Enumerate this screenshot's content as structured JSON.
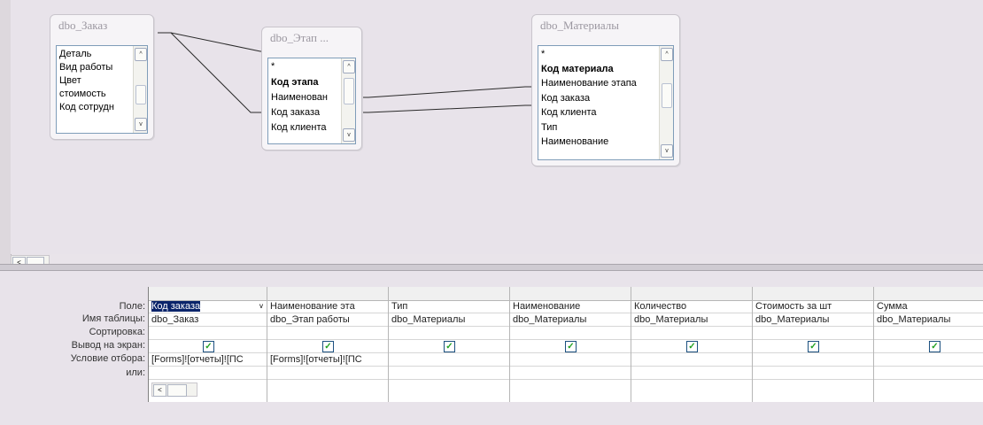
{
  "design": {
    "tables": [
      {
        "title": "dbo_Заказ",
        "fields": [
          "Деталь",
          "Вид работы",
          "Цвет",
          "стоимость",
          "Код сотрудн"
        ],
        "bold": []
      },
      {
        "title": "dbo_Этап ...",
        "fields": [
          "*",
          "Код этапа",
          "Наименован",
          "Код заказа",
          "Код клиента"
        ],
        "bold": [
          1
        ]
      },
      {
        "title": "dbo_Материалы",
        "fields": [
          "*",
          "Код материала",
          "Наименование этапа",
          "Код заказа",
          "Код клиента",
          "Тип",
          "Наименование"
        ],
        "bold": [
          1
        ]
      }
    ],
    "scroll_left": "<",
    "scroll_up": "^",
    "scroll_down": "v"
  },
  "grid": {
    "row_labels": [
      "Поле:",
      "Имя таблицы:",
      "Сортировка:",
      "Вывод на экран:",
      "Условие отбора:",
      "или:"
    ],
    "columns": [
      {
        "field": "Код заказа",
        "table": "dbo_Заказ",
        "sort": "",
        "show": true,
        "criteria": "[Forms]![отчеты]![ПС",
        "or": ""
      },
      {
        "field": "Наименование эта",
        "table": "dbo_Этап работы",
        "sort": "",
        "show": true,
        "criteria": "[Forms]![отчеты]![ПС",
        "or": ""
      },
      {
        "field": "Тип",
        "table": "dbo_Материалы",
        "sort": "",
        "show": true,
        "criteria": "",
        "or": ""
      },
      {
        "field": "Наименование",
        "table": "dbo_Материалы",
        "sort": "",
        "show": true,
        "criteria": "",
        "or": ""
      },
      {
        "field": "Количество",
        "table": "dbo_Материалы",
        "sort": "",
        "show": true,
        "criteria": "",
        "or": ""
      },
      {
        "field": "Стоимость за шт",
        "table": "dbo_Материалы",
        "sort": "",
        "show": true,
        "criteria": "",
        "or": ""
      },
      {
        "field": "Сумма",
        "table": "dbo_Материалы",
        "sort": "",
        "show": true,
        "criteria": "",
        "or": ""
      }
    ],
    "dropdown_glyph": "v",
    "check_glyph": "✓",
    "scroll_left": "<"
  }
}
